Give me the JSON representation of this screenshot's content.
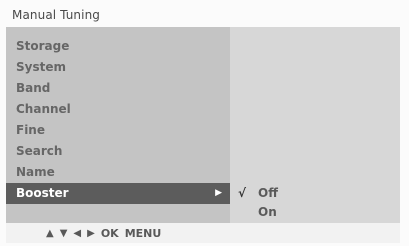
{
  "title": "Manual Tuning",
  "menu": {
    "items": [
      {
        "label": "Storage"
      },
      {
        "label": "System"
      },
      {
        "label": "Band"
      },
      {
        "label": "Channel"
      },
      {
        "label": "Fine"
      },
      {
        "label": "Search"
      },
      {
        "label": "Name"
      },
      {
        "label": "Booster",
        "selected": true
      }
    ]
  },
  "options": {
    "items": [
      {
        "label": "Off",
        "checked": true
      },
      {
        "label": "On",
        "checked": false
      }
    ],
    "check_glyph": "√"
  },
  "footer": {
    "icons": [
      "arrow-up-icon",
      "arrow-down-icon",
      "arrow-left-icon",
      "arrow-right-icon"
    ],
    "ok_label": "OK",
    "menu_label": "MENU"
  },
  "colors": {
    "selected_background": "#5c5c5c",
    "left_panel": "#c4c4c4",
    "right_panel": "#d7d7d7"
  }
}
